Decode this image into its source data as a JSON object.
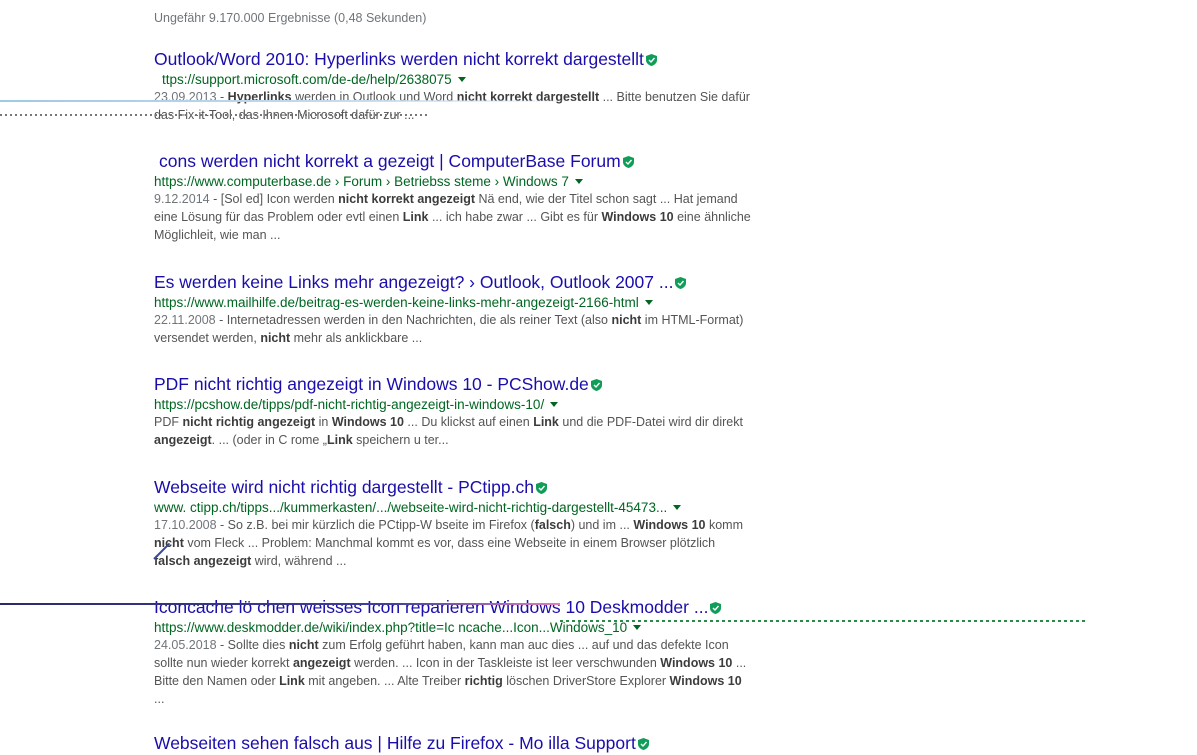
{
  "stats": "Ungefähr 9.170.000 Ergebnisse (0,48 Sekunden)",
  "accent_colors": {
    "link": "#1a0dab",
    "url": "#006621",
    "snippet": "#545454",
    "verified_badge": "#0f9d58"
  },
  "results": [
    {
      "title": "Outlook/Word 2010: Hyperlinks werden nicht korrekt dargestellt",
      "url": "ttps://support.microsoft.com/de-de/help/2638075",
      "date": "23.09.2013",
      "snippet_parts": [
        {
          "t": " - ",
          "b": false
        },
        {
          "t": "Hyperlinks",
          "b": true
        },
        {
          "t": " werden in Outlook und Word ",
          "b": false
        },
        {
          "t": "nicht korrekt dargestellt",
          "b": true
        },
        {
          "t": " ... Bitte benutzen Sie dafür das Fix-it-Tool, das Ihnen Microsoft dafür zur ...",
          "b": false
        }
      ]
    },
    {
      "title": "cons werden nicht korrekt a gezeigt | ComputerBase Forum",
      "url": "https://www.computerbase.de  › Forum › Betriebss  steme › Windows 7",
      "date": "9.12.2014",
      "snippet_parts": [
        {
          "t": " - [Sol ed] Icon  werden ",
          "b": false
        },
        {
          "t": "nicht korrekt angezeigt",
          "b": true
        },
        {
          "t": " Nä end, wie der Titel schon sagt ... Hat jemand eine Lösung für das Problem oder evtl einen ",
          "b": false
        },
        {
          "t": "Link",
          "b": true
        },
        {
          "t": " ... ich habe zwar ... Gibt es für ",
          "b": false
        },
        {
          "t": "Windows 10",
          "b": true
        },
        {
          "t": " eine ähnliche Möglichleit, wie man ...",
          "b": false
        }
      ]
    },
    {
      "title": "Es werden keine Links mehr angezeigt? › Outlook, Outlook 2007 ...",
      "url": "https://www.mailhilfe.de/beitrag-es-werden-keine-links-mehr-angezeigt-2166-html",
      "date": "22.11.2008",
      "snippet_parts": [
        {
          "t": " - Internetadressen werden in den Nachrichten, die als reiner Text (also ",
          "b": false
        },
        {
          "t": "nicht",
          "b": true
        },
        {
          "t": " im HTML-Format) versendet werden, ",
          "b": false
        },
        {
          "t": "nicht",
          "b": true
        },
        {
          "t": " mehr als anklickbare ...",
          "b": false
        }
      ]
    },
    {
      "title": "PDF nicht richtig angezeigt in Windows 10 - PCShow.de",
      "url": "https://pcshow.de/tipps/pdf-nicht-richtig-angezeigt-in-windows-10/",
      "date": "",
      "snippet_parts": [
        {
          "t": "PDF ",
          "b": false
        },
        {
          "t": "nicht richtig angezeigt",
          "b": true
        },
        {
          "t": " in ",
          "b": false
        },
        {
          "t": "Windows 10",
          "b": true
        },
        {
          "t": " ... Du klickst auf einen ",
          "b": false
        },
        {
          "t": "Link",
          "b": true
        },
        {
          "t": " und die PDF-Datei wird dir direkt ",
          "b": false
        },
        {
          "t": "angezeigt",
          "b": true
        },
        {
          "t": ". ... (oder in C rome „",
          "b": false
        },
        {
          "t": "Link",
          "b": true
        },
        {
          "t": " speichern u ter...",
          "b": false
        }
      ]
    },
    {
      "title": "Webseite wird nicht richtig dargestellt - PCtipp.ch",
      "url": "www.  ctipp.ch/tipps.../kummerkasten/.../webseite-wird-nicht-richtig-dargestellt-45473...",
      "date": "17.10.2008",
      "snippet_parts": [
        {
          "t": " - So z.B. bei mir kürzlich die PCtipp-W  bseite im Firefox (",
          "b": false
        },
        {
          "t": "falsch",
          "b": true
        },
        {
          "t": ") und im ... ",
          "b": false
        },
        {
          "t": "Windows 10",
          "b": true
        },
        {
          "t": " komm  ",
          "b": false
        },
        {
          "t": "nicht",
          "b": true
        },
        {
          "t": " vom Fleck ... Problem: Manchmal kommt es vor, dass eine Webseite in einem Browser plötzlich ",
          "b": false
        },
        {
          "t": "falsch angezeigt",
          "b": true
        },
        {
          "t": " wird, während ...",
          "b": false
        }
      ]
    },
    {
      "title": "Iconcache lö chen weisses Icon reparieren Windows 10 Deskmodder ...",
      "url": "https://www.deskmodder.de/wiki/index.php?title=Ic  ncache...Icon...Windows_10",
      "date": "24.05.2018",
      "snippet_parts": [
        {
          "t": " - Sollte dies ",
          "b": false
        },
        {
          "t": "nicht",
          "b": true
        },
        {
          "t": " zum Erfolg geführt haben, kann man auc  dies ... auf und das defekte Icon sollte nun wieder korrekt ",
          "b": false
        },
        {
          "t": "angezeigt",
          "b": true
        },
        {
          "t": " werden. ... Icon in der Taskleiste ist leer verschwunden ",
          "b": false
        },
        {
          "t": "Windows 10",
          "b": true
        },
        {
          "t": " ... Bitte den Namen oder ",
          "b": false
        },
        {
          "t": "Link",
          "b": true
        },
        {
          "t": " mit angeben. ... Alte Treiber ",
          "b": false
        },
        {
          "t": "richtig",
          "b": true
        },
        {
          "t": " löschen DriverStore Explorer ",
          "b": false
        },
        {
          "t": "Windows 10",
          "b": true
        },
        {
          "t": " ...",
          "b": false
        }
      ]
    },
    {
      "title": "Webseiten sehen falsch aus | Hilfe zu Firefox - Mo illa Support",
      "url": "",
      "date": "",
      "snippet_parts": []
    }
  ]
}
